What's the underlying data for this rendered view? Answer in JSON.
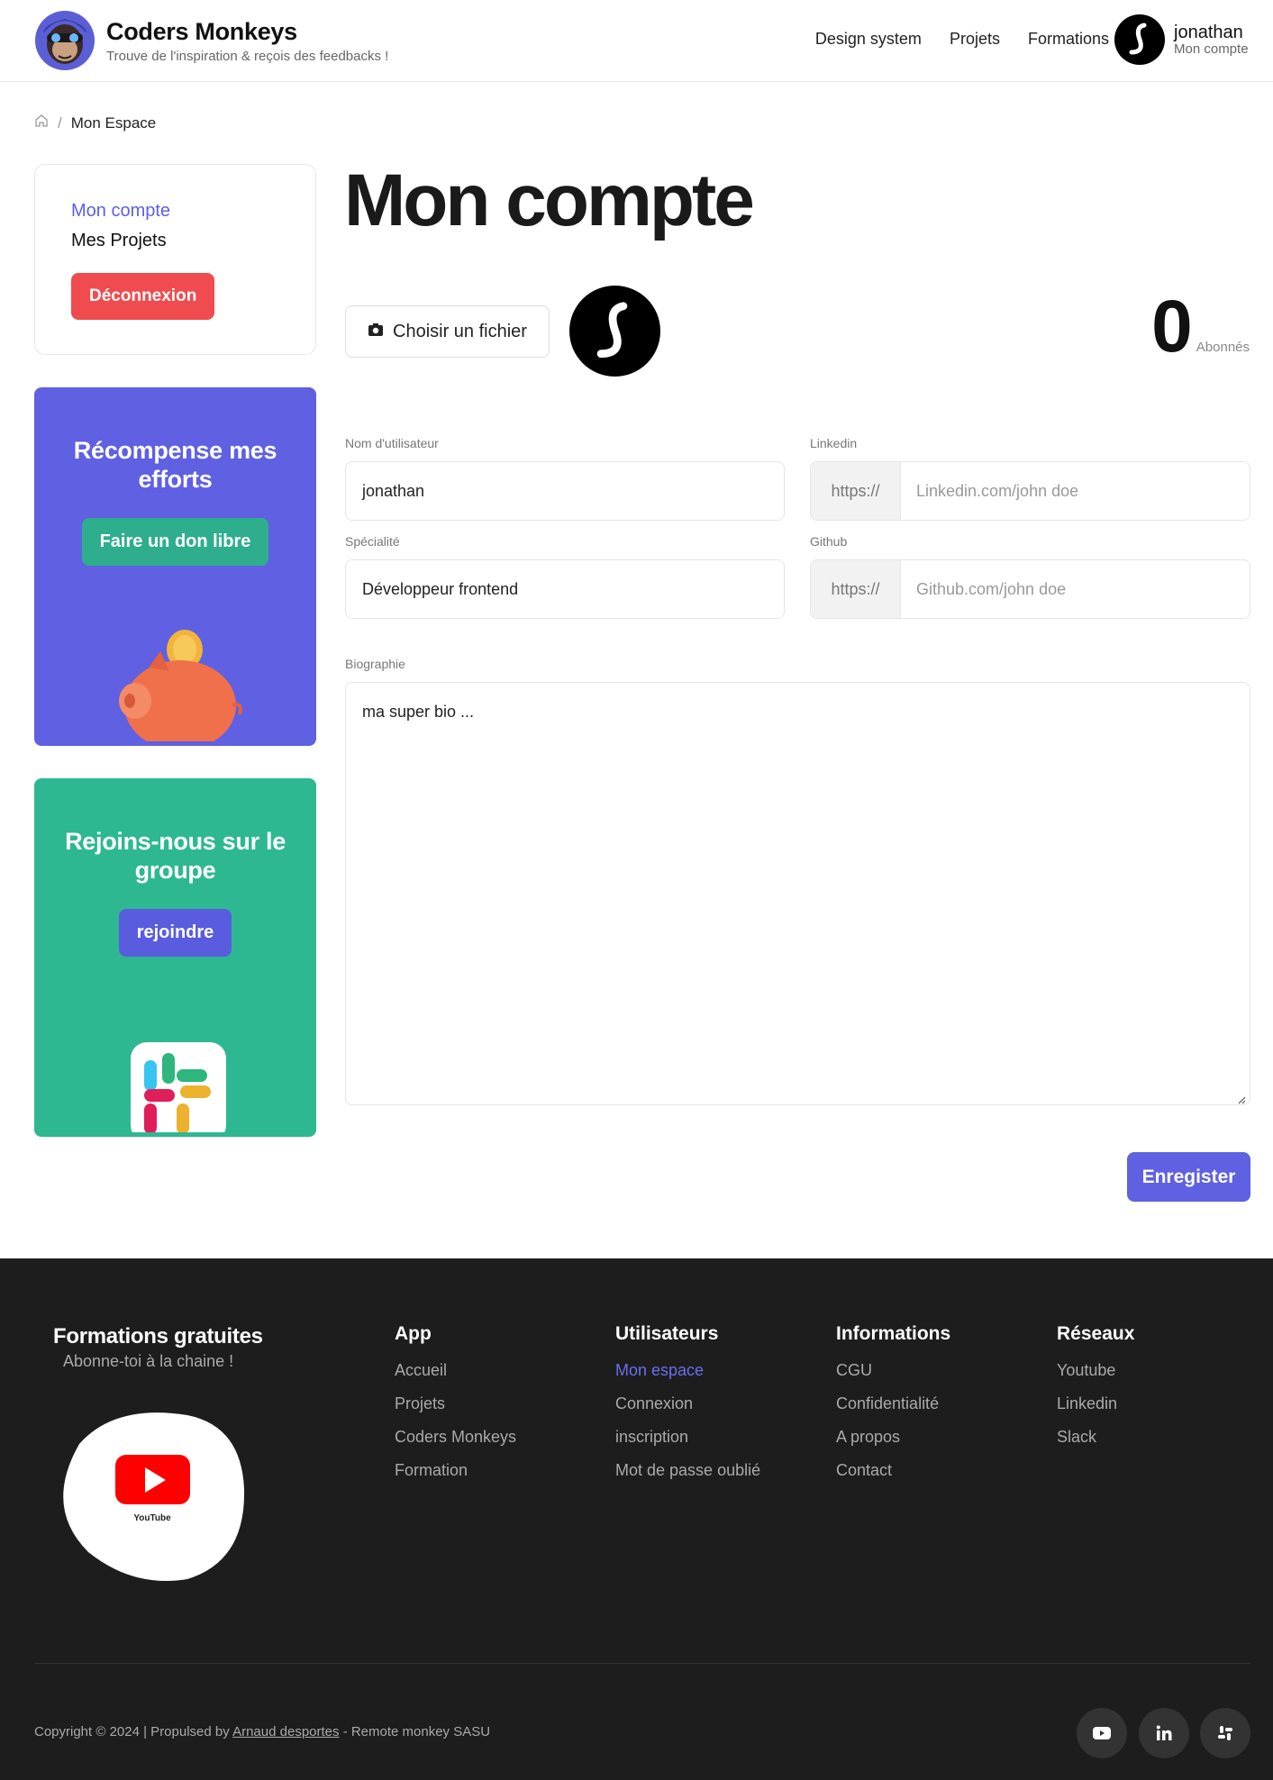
{
  "header": {
    "brand_name": "Coders Monkeys",
    "brand_tagline": "Trouve de l'inspiration & reçois des feedbacks !",
    "nav": [
      "Design system",
      "Projets",
      "Formations"
    ],
    "user_name": "jonathan",
    "user_sub": "Mon compte"
  },
  "breadcrumb": {
    "current": "Mon Espace",
    "separator": "/"
  },
  "sidebar": {
    "links": [
      "Mon compte",
      "Mes Projets"
    ],
    "logout_label": "Déconnexion",
    "promo_donate": {
      "title": "Récompense mes efforts",
      "button": "Faire un don libre"
    },
    "promo_group": {
      "title": "Rejoins-nous sur le groupe",
      "button": "rejoindre"
    }
  },
  "main": {
    "title": "Mon compte",
    "file_button": "Choisir un fichier",
    "followers_count": "0",
    "followers_label": "Abonnés",
    "fields": {
      "username": {
        "label": "Nom d'utilisateur",
        "value": "jonathan"
      },
      "specialty": {
        "label": "Spécialité",
        "value": "Développeur frontend"
      },
      "linkedin": {
        "label": "Linkedin",
        "prefix": "https://",
        "placeholder": "Linkedin.com/john doe"
      },
      "github": {
        "label": "Github",
        "prefix": "https://",
        "placeholder": "Github.com/john doe"
      },
      "bio": {
        "label": "Biographie",
        "value": "ma super bio ..."
      }
    },
    "save_label": "Enregister"
  },
  "footer": {
    "promo_title": "Formations gratuites",
    "promo_sub": "Abonne-toi à la chaine !",
    "youtube_logo_text": "YouTube",
    "columns": [
      {
        "title": "App",
        "links": [
          "Accueil",
          "Projets",
          "Coders Monkeys",
          "Formation"
        ]
      },
      {
        "title": "Utilisateurs",
        "links": [
          "Mon espace",
          "Connexion",
          "inscription",
          "Mot de passe oublié"
        ]
      },
      {
        "title": "Informations",
        "links": [
          "CGU",
          "Confidentialité",
          "A propos",
          "Contact"
        ]
      },
      {
        "title": "Réseaux",
        "links": [
          "Youtube",
          "Linkedin",
          "Slack"
        ]
      }
    ],
    "copyright_pre": "Copyright © 2024 | Propulsed by",
    "copyright_author": "Arnaud desportes",
    "copyright_post": "- Remote monkey SASU",
    "social_icons": [
      "youtube-icon",
      "linkedin-icon",
      "slack-icon"
    ]
  },
  "colors": {
    "accent": "#5f60e2",
    "danger": "#f04b4f",
    "green": "#2eb892",
    "footer_bg": "#1d1d1d"
  }
}
